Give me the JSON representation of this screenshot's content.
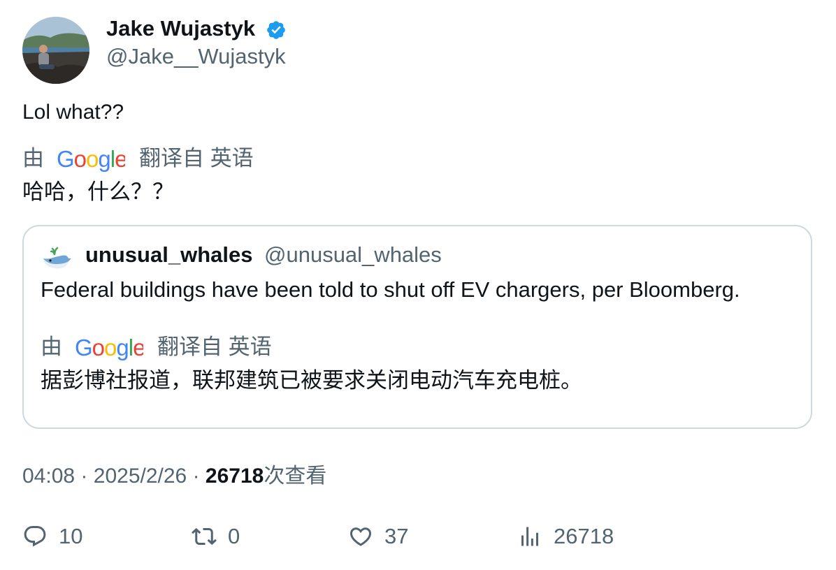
{
  "author": {
    "display_name": "Jake Wujastyk",
    "handle": "@Jake__Wujastyk",
    "verified_icon": "verified-badge-icon",
    "verified_color": "#1d9bf0"
  },
  "tweet": {
    "text": "Lol what??",
    "translation": {
      "by_label": "由",
      "brand": "Google",
      "translated_from_label": "翻译自 英语",
      "text": "哈哈，什么？？"
    }
  },
  "quote": {
    "avatar_icon": "whale-icon",
    "display_name": "unusual_whales",
    "handle": "@unusual_whales",
    "text": "Federal buildings have been told to shut off EV chargers, per Bloomberg.",
    "translation": {
      "by_label": "由",
      "brand": "Google",
      "translated_from_label": "翻译自 英语",
      "text": "据彭博社报道，联邦建筑已被要求关闭电动汽车充电桩。"
    }
  },
  "meta": {
    "time": "04:08",
    "separator": "·",
    "date": "2025/2/26",
    "views_count": "26718",
    "views_label": "次查看"
  },
  "actions": {
    "reply": {
      "icon": "reply-icon",
      "count": "10"
    },
    "retweet": {
      "icon": "retweet-icon",
      "count": "0"
    },
    "like": {
      "icon": "heart-icon",
      "count": "37"
    },
    "views": {
      "icon": "analytics-icon",
      "count": "26718"
    }
  },
  "colors": {
    "text_primary": "#0f1419",
    "text_secondary": "#536471",
    "border": "#cfd9de",
    "google_blue": "#4285F4",
    "google_red": "#EA4335",
    "google_yellow": "#FBBC05",
    "google_green": "#34A853"
  }
}
